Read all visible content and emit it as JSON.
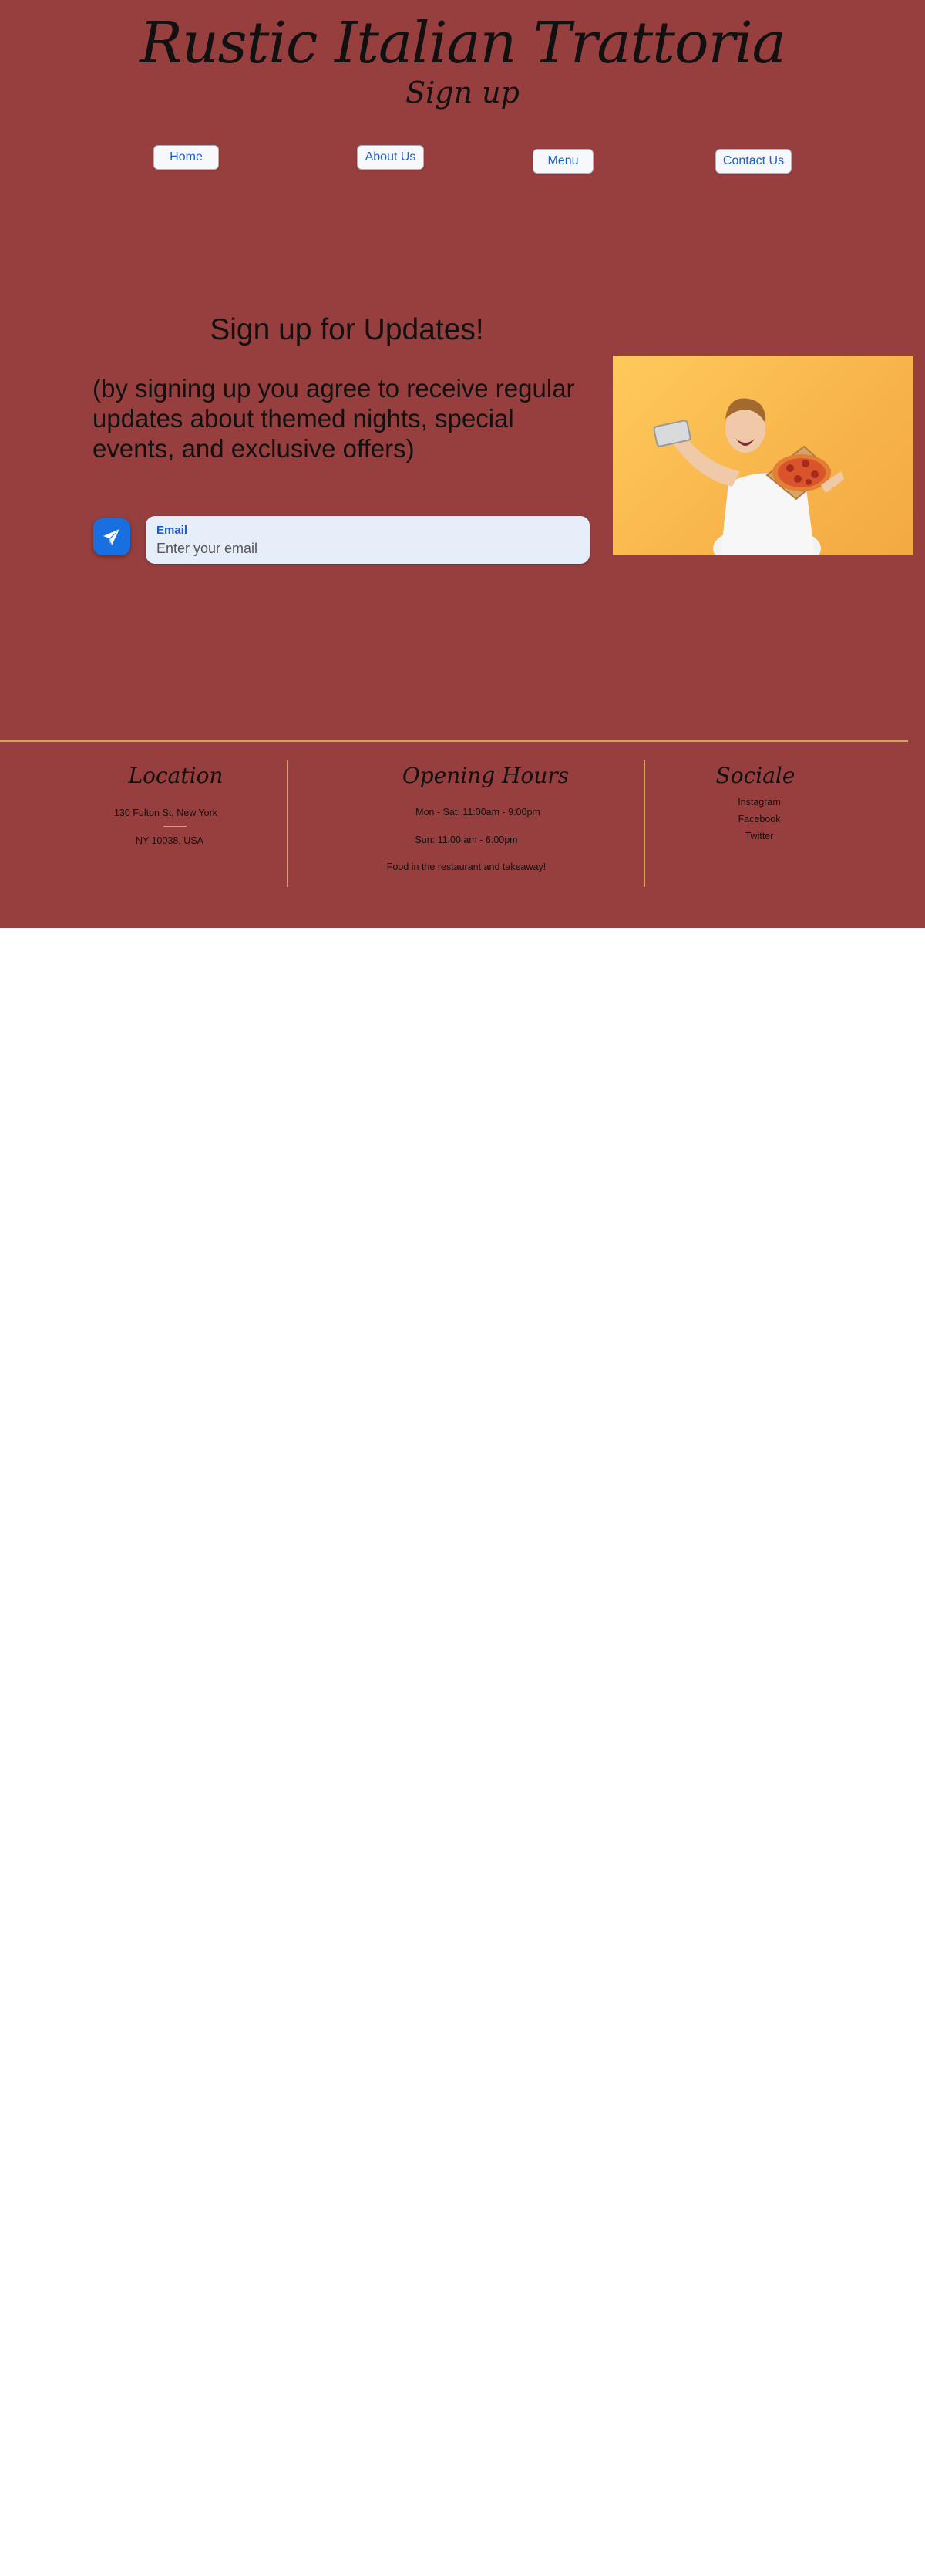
{
  "header": {
    "site_title": "Rustic Italian Trattoria",
    "page_subtitle": "Sign up"
  },
  "nav": {
    "home": "Home",
    "about": "About Us",
    "menu": "Menu",
    "contact": "Contact Us"
  },
  "signup": {
    "heading": "Sign up for Updates!",
    "note": "(by signing up you agree to receive regular updates about themed nights, special events, and exclusive offers)",
    "email_label": "Email",
    "email_placeholder": "Enter your email",
    "email_value": "",
    "send_icon": "paper-plane-icon"
  },
  "footer": {
    "location": {
      "title": "Location",
      "line1": "130 Fulton St,  New York",
      "line2": "NY 10038, USA"
    },
    "hours": {
      "title": "Opening Hours",
      "weekdays": "Mon - Sat: 11:00am - 9:00pm",
      "sunday": "Sun: 11:00 am - 6:00pm",
      "note": "Food in the restaurant and takeaway!"
    },
    "socials": {
      "title": "Sociale",
      "links": [
        "Instagram",
        "Facebook",
        "Twitter"
      ]
    }
  },
  "colors": {
    "background": "#973f3f",
    "accent_line": "#d9a160",
    "button_blue": "#1a6fe0",
    "link_blue": "#1a5fd0"
  }
}
